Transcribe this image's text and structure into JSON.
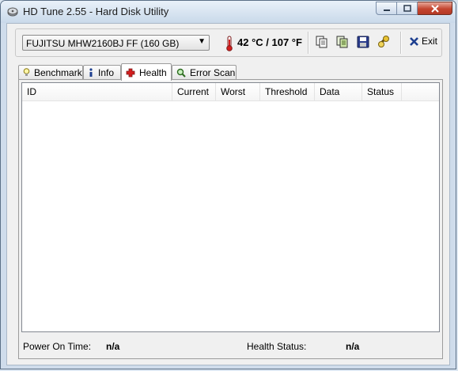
{
  "window": {
    "title": "HD Tune 2.55 - Hard Disk Utility"
  },
  "toolbar": {
    "drive": "FUJITSU MHW2160BJ FF (160 GB)",
    "temperature": "42 °C / 107 °F",
    "exit_label": "Exit"
  },
  "tabs": [
    {
      "label": "Benchmark"
    },
    {
      "label": "Info"
    },
    {
      "label": "Health"
    },
    {
      "label": "Error Scan"
    }
  ],
  "table": {
    "columns": [
      "ID",
      "Current",
      "Worst",
      "Threshold",
      "Data",
      "Status"
    ],
    "rows": []
  },
  "footer": {
    "power_on_label": "Power On Time:",
    "power_on_value": "n/a",
    "health_label": "Health Status:",
    "health_value": "n/a"
  },
  "colors": {
    "titlebar": "#c9d9ea",
    "close_button": "#c4452f",
    "window_bg": "#f0f0f0"
  }
}
